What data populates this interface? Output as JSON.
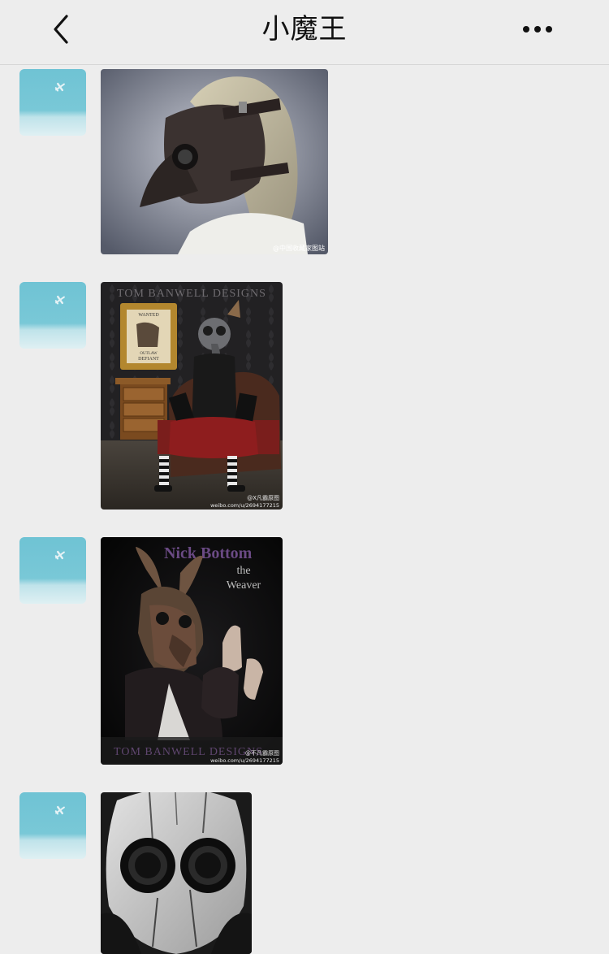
{
  "header": {
    "title": "小魔王",
    "back_icon": "chevron-left-icon",
    "more_icon": "more-dots-icon"
  },
  "messages": [
    {
      "avatar_icon": "airplane-icon",
      "image": {
        "subject": "plague-doctor-leather-mask",
        "watermark": "@中国收藏家图站"
      }
    },
    {
      "avatar_icon": "airplane-icon",
      "image": {
        "subject": "gas-mask-woman-on-sofa",
        "header_text": "TOM BANWELL DESIGNS",
        "frame_text_top": "WANTED",
        "frame_text_mid": "OUTLAW",
        "frame_text_bottom": "DEFIANT",
        "watermark": "@X凡霸原图",
        "watermark_url": "weibo.com/u/2694177215"
      }
    },
    {
      "avatar_icon": "airplane-icon",
      "image": {
        "subject": "donkey-mask-performer",
        "title": "Nick Bottom",
        "subtitle_1": "the",
        "subtitle_2": "Weaver",
        "footer_text": "TOM BANWELL DESIGNS",
        "watermark": "@不凡霸原图",
        "watermark_url": "weibo.com/u/2694177215"
      }
    },
    {
      "avatar_icon": "airplane-icon",
      "image": {
        "subject": "black-white-gas-mask"
      }
    }
  ]
}
